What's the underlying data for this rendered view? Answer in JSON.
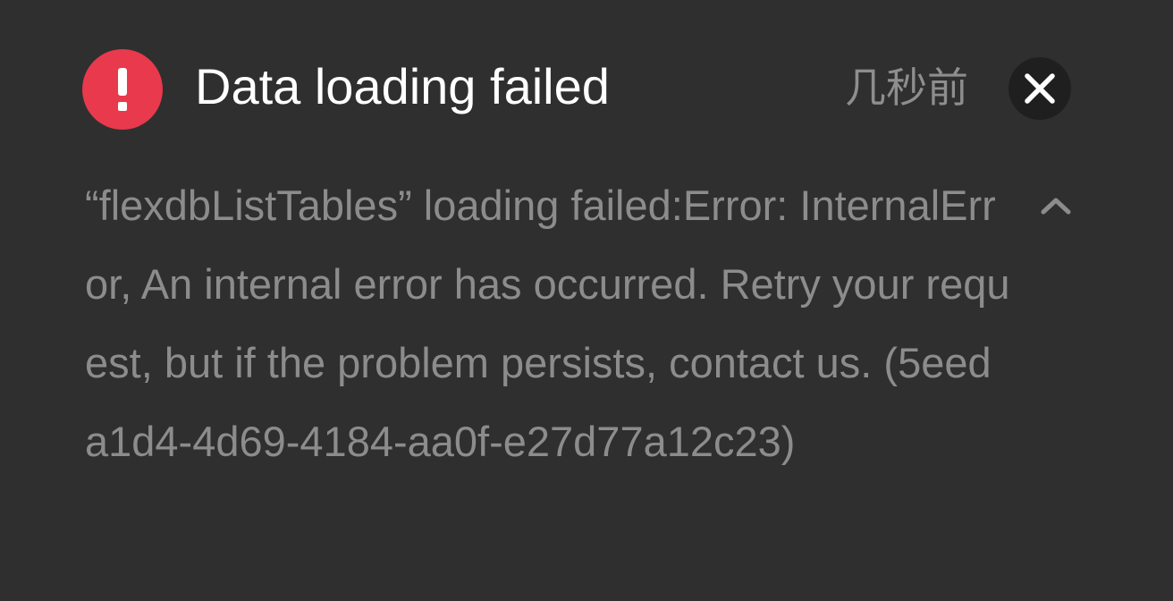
{
  "notification": {
    "title": "Data loading failed",
    "time": "几秒前",
    "message": "“flexdbListTables” loading failed:Error: InternalError, An internal error has occurred. Retry your request, but if the problem persists, contact us. (5eeda1d4-4d69-4184-aa0f-e27d77a12c23)",
    "icons": {
      "status": "error-icon",
      "close": "close-icon",
      "collapse": "chevron-up-icon"
    },
    "colors": {
      "background": "#2f2f2f",
      "error_accent": "#e8394d",
      "title": "#ffffff",
      "secondary_text": "#8c8c8c"
    }
  }
}
